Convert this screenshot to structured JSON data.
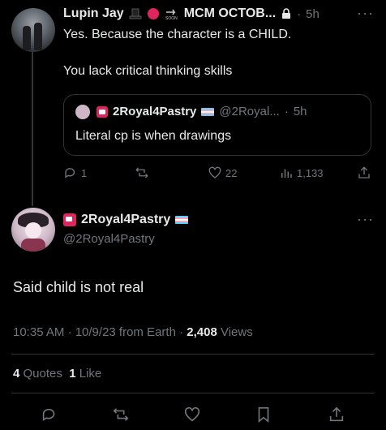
{
  "reply": {
    "author_name": "Lupin Jay",
    "author_suffix": "MCM OCTOB...",
    "time": "5h",
    "line1": "Yes. Because the character is a CHILD.",
    "line2": "You lack critical thinking skills",
    "badges": [
      "top-hat-icon",
      "red-circle-icon",
      "soon-arrow-icon",
      "lock-icon"
    ],
    "quote": {
      "author_name": "2Royal4Pastry",
      "handle": "@2Royal...",
      "time": "5h",
      "text": "Literal cp is when drawings"
    },
    "actions": {
      "replies": "1",
      "reposts": "",
      "likes": "22",
      "views": "1,133"
    }
  },
  "main_post": {
    "author_name": "2Royal4Pastry",
    "handle": "@2Royal4Pastry",
    "text": "Said child is not real",
    "meta_time": "10:35 AM · 10/9/23 from Earth · ",
    "views_count": "2,408",
    "views_label": " Views",
    "quotes_count": "4",
    "quotes_label": "Quotes",
    "likes_count": "1",
    "likes_label": "Like"
  },
  "colors": {
    "background": "#000000",
    "text": "#e7e9ea",
    "muted": "#71767b",
    "divider": "#2f3336"
  }
}
